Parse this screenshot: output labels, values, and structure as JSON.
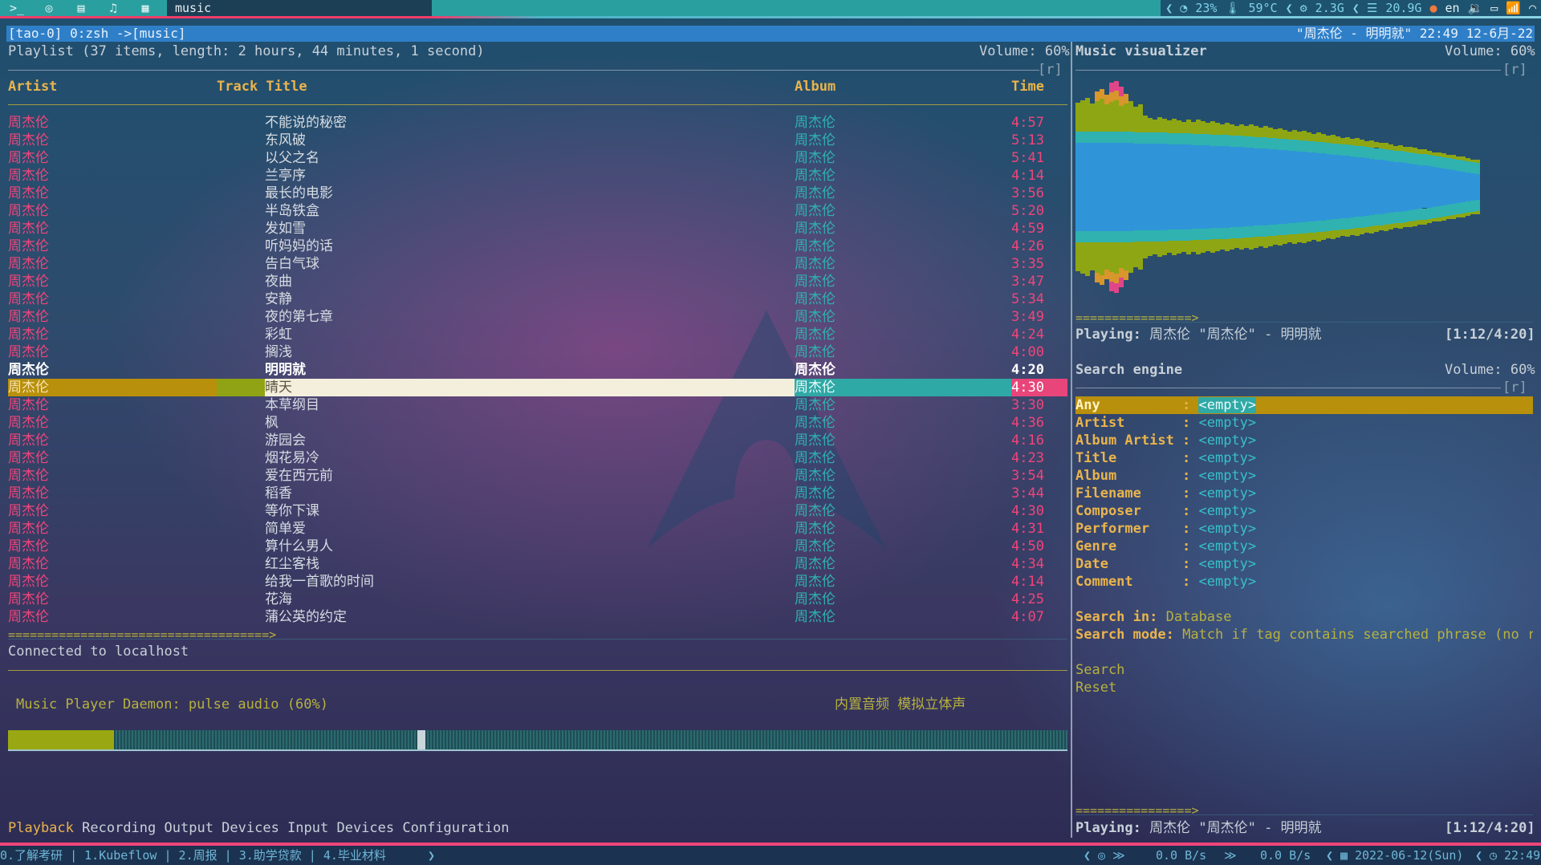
{
  "topbar": {
    "icons": [
      "terminal-icon",
      "chrome-icon",
      "chat-icon",
      "music-note-icon",
      "apps-icon"
    ],
    "window_title": "music",
    "cpu": "23%",
    "temp": "59°C",
    "mem": "2.3G",
    "disk": "20.9G",
    "lang": "en"
  },
  "tmux": {
    "left": "[tao-0] 0:zsh  ->[music]",
    "right": "\"周杰伦 - 明明就\" 22:49 12-6月-22"
  },
  "playlist": {
    "summary": "Playlist (37 items, length: 2 hours, 44 minutes, 1 second)",
    "volume": "Volume: 60%",
    "flag": "[r]",
    "columns": {
      "artist": "Artist",
      "title": "Track Title",
      "album": "Album",
      "time": "Time"
    },
    "rows": [
      {
        "artist": "周杰伦",
        "title": "不能说的秘密",
        "album": "周杰伦",
        "time": "4:57"
      },
      {
        "artist": "周杰伦",
        "title": "东风破",
        "album": "周杰伦",
        "time": "5:13"
      },
      {
        "artist": "周杰伦",
        "title": "以父之名",
        "album": "周杰伦",
        "time": "5:41"
      },
      {
        "artist": "周杰伦",
        "title": "兰亭序",
        "album": "周杰伦",
        "time": "4:14"
      },
      {
        "artist": "周杰伦",
        "title": "最长的电影",
        "album": "周杰伦",
        "time": "3:56"
      },
      {
        "artist": "周杰伦",
        "title": "半岛铁盒",
        "album": "周杰伦",
        "time": "5:20"
      },
      {
        "artist": "周杰伦",
        "title": "发如雪",
        "album": "周杰伦",
        "time": "4:59"
      },
      {
        "artist": "周杰伦",
        "title": "听妈妈的话",
        "album": "周杰伦",
        "time": "4:26"
      },
      {
        "artist": "周杰伦",
        "title": "告白气球",
        "album": "周杰伦",
        "time": "3:35"
      },
      {
        "artist": "周杰伦",
        "title": "夜曲",
        "album": "周杰伦",
        "time": "3:47"
      },
      {
        "artist": "周杰伦",
        "title": "安静",
        "album": "周杰伦",
        "time": "5:34"
      },
      {
        "artist": "周杰伦",
        "title": "夜的第七章",
        "album": "周杰伦",
        "time": "3:49"
      },
      {
        "artist": "周杰伦",
        "title": "彩虹",
        "album": "周杰伦",
        "time": "4:24"
      },
      {
        "artist": "周杰伦",
        "title": "搁浅",
        "album": "周杰伦",
        "time": "4:00"
      },
      {
        "artist": "周杰伦",
        "title": "明明就",
        "album": "周杰伦",
        "time": "4:20",
        "state": "playing"
      },
      {
        "artist": "周杰伦",
        "title": "晴天",
        "album": "周杰伦",
        "time": "4:30",
        "state": "selected"
      },
      {
        "artist": "周杰伦",
        "title": "本草纲目",
        "album": "周杰伦",
        "time": "3:30"
      },
      {
        "artist": "周杰伦",
        "title": "枫",
        "album": "周杰伦",
        "time": "4:36"
      },
      {
        "artist": "周杰伦",
        "title": "游园会",
        "album": "周杰伦",
        "time": "4:16"
      },
      {
        "artist": "周杰伦",
        "title": "烟花易冷",
        "album": "周杰伦",
        "time": "4:23"
      },
      {
        "artist": "周杰伦",
        "title": "爱在西元前",
        "album": "周杰伦",
        "time": "3:54"
      },
      {
        "artist": "周杰伦",
        "title": "稻香",
        "album": "周杰伦",
        "time": "3:44"
      },
      {
        "artist": "周杰伦",
        "title": "等你下课",
        "album": "周杰伦",
        "time": "4:30"
      },
      {
        "artist": "周杰伦",
        "title": "简单爱",
        "album": "周杰伦",
        "time": "4:31"
      },
      {
        "artist": "周杰伦",
        "title": "算什么男人",
        "album": "周杰伦",
        "time": "4:50"
      },
      {
        "artist": "周杰伦",
        "title": "红尘客栈",
        "album": "周杰伦",
        "time": "4:34"
      },
      {
        "artist": "周杰伦",
        "title": "给我一首歌的时间",
        "album": "周杰伦",
        "time": "4:14"
      },
      {
        "artist": "周杰伦",
        "title": "花海",
        "album": "周杰伦",
        "time": "4:25"
      },
      {
        "artist": "周杰伦",
        "title": "蒲公英的约定",
        "album": "周杰伦",
        "time": "4:07"
      }
    ],
    "progress_arrow": "====================================>",
    "status": "Connected to localhost"
  },
  "mixer": {
    "daemon": "Music Player Daemon: pulse audio (60%)",
    "device": "内置音频 模拟立体声",
    "level": 0.1,
    "tabs": [
      "Playback",
      "Recording",
      "Output Devices",
      "Input Devices",
      "Configuration"
    ],
    "active_tab": "Playback"
  },
  "visualizer": {
    "title": "Music visualizer",
    "volume": "Volume: 60%",
    "flag": "[r]",
    "progress_arrow": "================>",
    "playing_label": "Playing:",
    "playing_text": "周杰伦 \"周杰伦\" - 明明就",
    "elapsed": "[1:12/4:20]"
  },
  "search": {
    "title": "Search engine",
    "volume": "Volume: 60%",
    "flag": "[r]",
    "fields": [
      {
        "label": "Any",
        "value": "<empty>"
      },
      {
        "label": "Artist",
        "value": "<empty>"
      },
      {
        "label": "Album Artist",
        "value": "<empty>"
      },
      {
        "label": "Title",
        "value": "<empty>"
      },
      {
        "label": "Album",
        "value": "<empty>"
      },
      {
        "label": "Filename",
        "value": "<empty>"
      },
      {
        "label": "Composer",
        "value": "<empty>"
      },
      {
        "label": "Performer",
        "value": "<empty>"
      },
      {
        "label": "Genre",
        "value": "<empty>"
      },
      {
        "label": "Date",
        "value": "<empty>"
      },
      {
        "label": "Comment",
        "value": "<empty>"
      }
    ],
    "search_in_label": "Search in:",
    "search_in_value": "Database",
    "mode_label": "Search mode:",
    "mode_value": "Match if tag contains searched phrase (no re",
    "actions": [
      "Search",
      "Reset"
    ],
    "progress_arrow": "================>",
    "playing_label": "Playing:",
    "playing_text": "周杰伦 \"周杰伦\" - 明明就",
    "elapsed": "[1:12/4:20]"
  },
  "bottombar": {
    "workspaces": "0.了解考研 | 1.Kubeflow | 2.周报 | 3.助学贷款 | 4.毕业材料",
    "down": "0.0 B/s",
    "up": "0.0 B/s",
    "date": "2022-06-12(Sun)",
    "time": "22:49"
  },
  "colors": {
    "accent_pink": "#f0457a",
    "accent_teal": "#2fb2b0",
    "header_gold": "#e9b44c",
    "tmux_blue": "#2f7fc8"
  }
}
